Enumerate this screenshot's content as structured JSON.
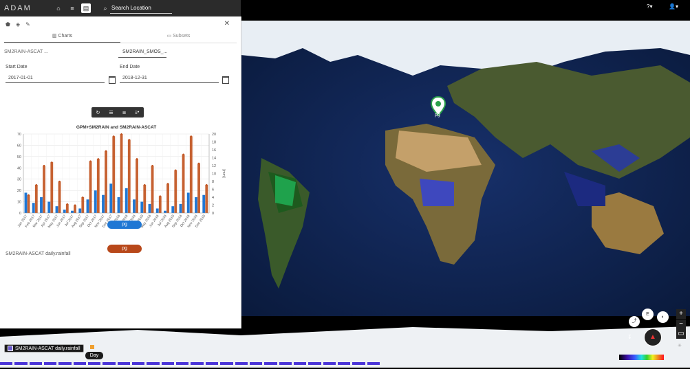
{
  "app": {
    "logo_text": "ADAM"
  },
  "search": {
    "placeholder": "Search Location"
  },
  "topbar_icons": [
    "home-icon",
    "layers-icon",
    "chart-icon",
    "search-icon"
  ],
  "panel": {
    "tabs": [
      {
        "label": "Charts",
        "icon": "chart-icon"
      },
      {
        "label": "Subsets",
        "icon": "subsets-icon"
      }
    ],
    "dataset_left": "SM2RAIN-ASCAT ...",
    "dataset_right": "SM2RAIN_SMOS_...",
    "start_date_label": "Start Date",
    "start_date_value": "2017-01-01",
    "end_date_label": "End Date",
    "end_date_value": "2018-12-31",
    "location_pill_1": "pg",
    "series_label": "SM2RAIN-ASCAT daily.rainfall",
    "location_pill_2": "pg"
  },
  "colors": {
    "blue_series": "#1f77d4",
    "orange_series": "#c0501b",
    "pill_blue": "#1f77d4",
    "pill_orange": "#b8481a"
  },
  "chart_data": {
    "type": "bar",
    "title": "GPM+SM2RAIN and SM2RAIN-ASCAT",
    "ylabel_right": "[mm]",
    "ylim_left": [
      0,
      70
    ],
    "ylim_right": [
      0,
      20
    ],
    "yticks_left": [
      0,
      10,
      20,
      30,
      40,
      50,
      60,
      70
    ],
    "yticks_right": [
      0,
      2,
      4,
      6,
      8,
      10,
      12,
      14,
      16,
      18,
      20
    ],
    "categories": [
      "Jan 2017",
      "Feb 2017",
      "Mar 2017",
      "Apr 2017",
      "May 2017",
      "Jun 2017",
      "Jul 2017",
      "Aug 2017",
      "Sep 2017",
      "Oct 2017",
      "Nov 2017",
      "Dec 2017",
      "Jan 2018",
      "Feb 2018",
      "Mar 2018",
      "Apr 2018",
      "May 2018",
      "Jun 2018",
      "Jul 2018",
      "Aug 2018",
      "Sep 2018",
      "Oct 2018",
      "Nov 2018",
      "Dec 2018"
    ],
    "series": [
      {
        "color": "#1f77d4",
        "values": [
          18,
          9,
          14,
          10,
          6,
          3,
          2,
          4,
          12,
          20,
          16,
          26,
          14,
          22,
          12,
          10,
          8,
          4,
          2,
          6,
          8,
          18,
          14,
          16
        ]
      },
      {
        "color": "#c0501b",
        "values": [
          16,
          25,
          42,
          45,
          28,
          8,
          7,
          14,
          46,
          48,
          55,
          68,
          70,
          65,
          48,
          25,
          42,
          15,
          26,
          38,
          52,
          68,
          44,
          25
        ]
      }
    ],
    "grid": true
  },
  "map": {
    "pin_label": "pg"
  },
  "bottom": {
    "legend_label": "SM2RAIN-ASCAT daily.rainfall",
    "day_button": "Day",
    "timeline_segments": 26
  },
  "topright": {
    "help": "?",
    "user": "user-icon"
  },
  "mapctl": {
    "e_label": "E",
    "zoom_in": "+",
    "zoom_out": "−"
  }
}
